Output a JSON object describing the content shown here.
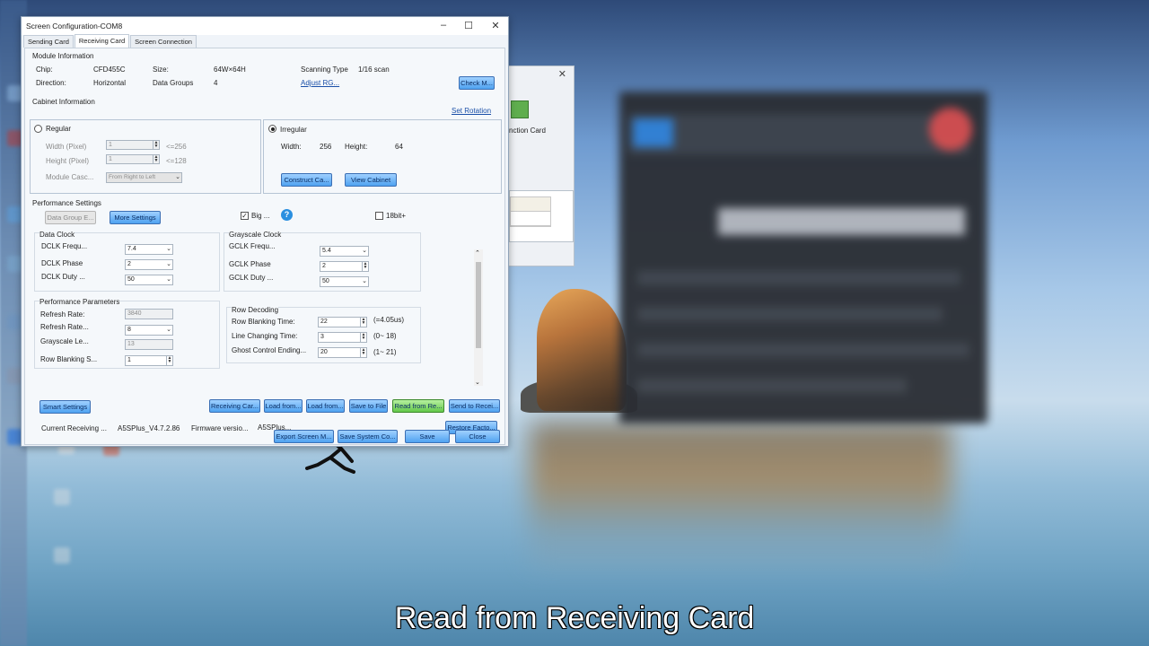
{
  "window": {
    "title": "Screen Configuration-COM8",
    "tabs": [
      "Sending Card",
      "Receiving Card",
      "Screen Connection"
    ],
    "active_tab": "Receiving Card"
  },
  "module_info": {
    "header": "Module Information",
    "chip_label": "Chip:",
    "chip_value": "CFD455C",
    "size_label": "Size:",
    "size_value": "64W×64H",
    "scanning_label": "Scanning Type",
    "scanning_value": "1/16 scan",
    "direction_label": "Direction:",
    "direction_value": "Horizontal",
    "groups_label": "Data Groups",
    "groups_value": "4",
    "adjust_link": "Adjust RG...",
    "check_button": "Check M..."
  },
  "cabinet": {
    "header": "Cabinet Information",
    "set_rotation": "Set Rotation",
    "regular_label": "Regular",
    "width_label": "Width (Pixel)",
    "width_value": "1",
    "width_limit": "<=256",
    "height_label": "Height (Pixel)",
    "height_value": "1",
    "height_limit": "<=128",
    "cascade_label": "Module Casc...",
    "cascade_value": "From Right to Left",
    "irregular_label": "Irregular",
    "irr_width_label": "Width:",
    "irr_width_value": "256",
    "irr_height_label": "Height:",
    "irr_height_value": "64",
    "construct_button": "Construct Ca...",
    "view_button": "View Cabinet"
  },
  "performance": {
    "header": "Performance Settings",
    "data_group_button": "Data Group E...",
    "more_settings_button": "More Settings",
    "big_label": "Big ...",
    "bit18_label": "18bit+",
    "data_clock": {
      "header": "Data Clock",
      "freq_label": "DCLK Frequ...",
      "freq_value": "7.4",
      "phase_label": "DCLK Phase",
      "phase_value": "2",
      "duty_label": "DCLK Duty ...",
      "duty_value": "50"
    },
    "grayscale_clock": {
      "header": "Grayscale Clock",
      "freq_label": "GCLK Frequ...",
      "freq_value": "5.4",
      "phase_label": "GCLK Phase",
      "phase_value": "2",
      "duty_label": "GCLK Duty ...",
      "duty_value": "50"
    },
    "params": {
      "header": "Performance Parameters",
      "refresh_label": "Refresh Rate:",
      "refresh_value": "3840",
      "refresh2_label": "Refresh Rate...",
      "refresh2_value": "8",
      "gray_label": "Grayscale Le...",
      "gray_value": "13",
      "blank_label": "Row Blanking S...",
      "blank_value": "1"
    },
    "row_decoding": {
      "header": "Row Decoding",
      "blank_label": "Row Blanking Time:",
      "blank_value": "22",
      "blank_note": "(=4.05us)",
      "line_label": "Line Changing Time:",
      "line_value": "3",
      "line_note": "(0~ 18)",
      "ghost_label": "Ghost Control Ending...",
      "ghost_value": "20",
      "ghost_note": "(1~ 21)"
    }
  },
  "actions": {
    "smart": "Smart Settings",
    "receiving": "Receiving Car...",
    "load1": "Load from...",
    "load2": "Load from...",
    "save_file": "Save to File",
    "read": "Read from Re...",
    "send": "Send to Recei...",
    "restore": "Restore Facto...",
    "current_label": "Current Receiving ...",
    "current_value": "A5SPlus_V4.7.2.86",
    "firmware_label": "Firmware versio...",
    "firmware_value": "A5SPlus...",
    "export": "Export Screen M...",
    "save_system": "Save System Co...",
    "save": "Save",
    "close": "Close"
  },
  "bg_window": {
    "label": "nction Card"
  },
  "caption": "Read from Receiving Card"
}
